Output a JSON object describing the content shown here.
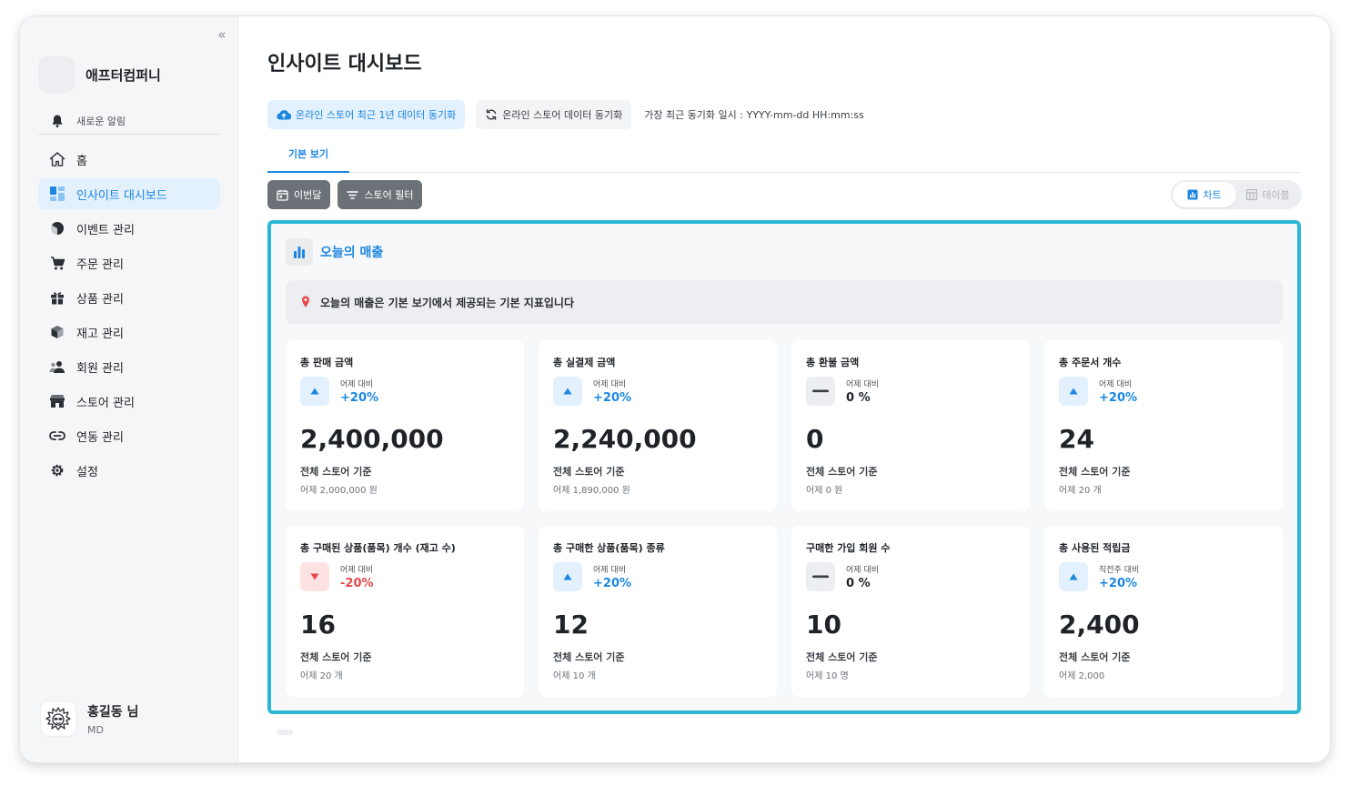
{
  "sidebar": {
    "company_name": "애프터컴퍼니",
    "notification_label": "새로운 알림",
    "items": [
      {
        "label": "홈",
        "icon": "home-icon"
      },
      {
        "label": "인사이트 대시보드",
        "icon": "dashboard-icon",
        "active": true
      },
      {
        "label": "이벤트 관리",
        "icon": "pie-icon"
      },
      {
        "label": "주문 관리",
        "icon": "cart-icon"
      },
      {
        "label": "상품 관리",
        "icon": "gift-icon"
      },
      {
        "label": "재고 관리",
        "icon": "box-icon"
      },
      {
        "label": "회원 관리",
        "icon": "users-icon"
      },
      {
        "label": "스토어 관리",
        "icon": "store-icon"
      },
      {
        "label": "연동 관리",
        "icon": "link-icon"
      },
      {
        "label": "설정",
        "icon": "gear-icon"
      }
    ],
    "user_name": "홍길동 님",
    "user_role": "MD"
  },
  "header": {
    "title": "인사이트 대시보드",
    "sync_year_label": "온라인 스토어 최근 1년 데이터 동기화",
    "sync_label": "온라인 스토어 데이터 동기화",
    "last_sync": "가장 최근 동기화 일시 : YYYY-mm-dd HH:mm:ss"
  },
  "tabs": [
    {
      "label": "기본 보기"
    }
  ],
  "filters": {
    "period_label": "이번달",
    "store_filter_label": "스토어 필터",
    "view_chart_label": "차트",
    "view_table_label": "테이블"
  },
  "panel": {
    "title": "오늘의 매출",
    "info": "오늘의 매출은 기본 보기에서 제공되는 기본 지표입니다",
    "cards": [
      {
        "title": "총 판매 금액",
        "compare_label": "어제 대비",
        "delta": "+20%",
        "trend": "up",
        "value": "2,400,000",
        "basis": "전체 스토어 기준",
        "prev": "어제 2,000,000 원"
      },
      {
        "title": "총 실결제 금액",
        "compare_label": "어제 대비",
        "delta": "+20%",
        "trend": "up",
        "value": "2,240,000",
        "basis": "전체 스토어 기준",
        "prev": "어제 1,890,000 원"
      },
      {
        "title": "총 환불 금액",
        "compare_label": "어제 대비",
        "delta": "0 %",
        "trend": "flat",
        "value": "0",
        "basis": "전체 스토어 기준",
        "prev": "어제 0 원"
      },
      {
        "title": "총 주문서 개수",
        "compare_label": "어제 대비",
        "delta": "+20%",
        "trend": "up",
        "value": "24",
        "basis": "전체 스토어 기준",
        "prev": "어제 20 개"
      },
      {
        "title": "총 구매된 상품(품목) 개수 (재고 수)",
        "compare_label": "어제 대비",
        "delta": "-20%",
        "trend": "down",
        "value": "16",
        "basis": "전체 스토어 기준",
        "prev": "어제 20 개"
      },
      {
        "title": "총 구매한 상품(품목) 종류",
        "compare_label": "어제 대비",
        "delta": "+20%",
        "trend": "up",
        "value": "12",
        "basis": "전체 스토어 기준",
        "prev": "어제 10 개"
      },
      {
        "title": "구매한 가입 회원 수",
        "compare_label": "어제 대비",
        "delta": "0 %",
        "trend": "flat",
        "value": "10",
        "basis": "전체 스토어 기준",
        "prev": "어제 10 명"
      },
      {
        "title": "총 사용된 적립금",
        "compare_label": "직전주 대비",
        "delta": "+20%",
        "trend": "up",
        "value": "2,400",
        "basis": "전체 스토어 기준",
        "prev": "어제 2,000"
      }
    ]
  },
  "colors": {
    "accent": "#1c86e0",
    "panel_border": "#2bb7d1",
    "negative": "#e5484d"
  }
}
